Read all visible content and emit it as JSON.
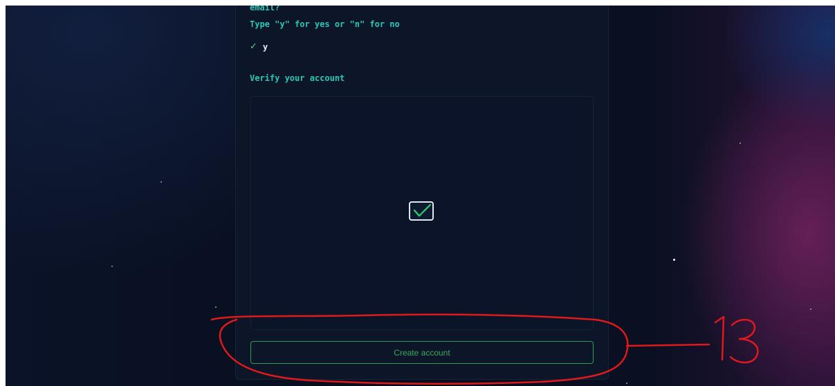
{
  "form": {
    "prompt_email_tail": "email?",
    "prompt_yn": "Type \"y\" for yes or \"n\" for no",
    "answer_value": "y",
    "answer_icon": "check-icon",
    "verify_label": "Verify your account",
    "verify_checked": true,
    "create_button_label": "Create account"
  },
  "annotation": {
    "label": "13",
    "color": "#e0191b"
  },
  "colors": {
    "prompt_text": "#2bc7b5",
    "accent_green": "#3ddc84",
    "panel_bg": "#0d1629"
  }
}
